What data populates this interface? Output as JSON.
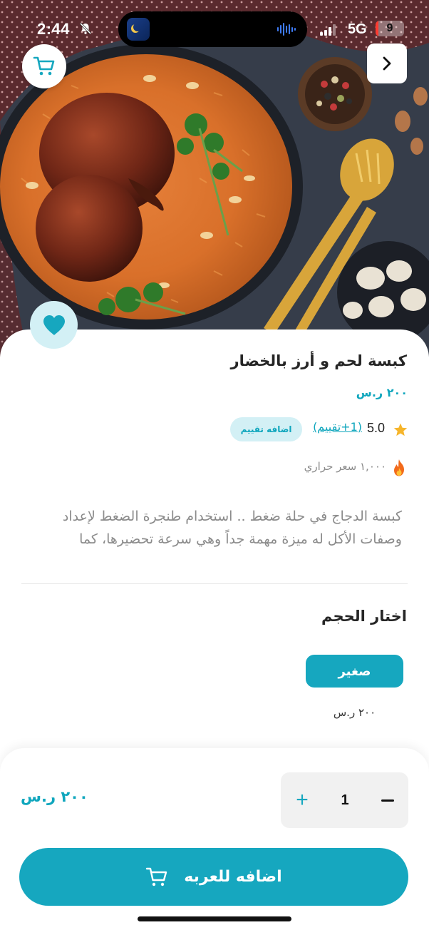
{
  "status_bar": {
    "time": "2:44",
    "network": "5G",
    "battery_level": "9",
    "battery_fraction": 0.09
  },
  "hero": {
    "image": "kabsa-chicken-rice-photo",
    "cart_icon": "cart-icon",
    "back_icon": "chevron-right-icon",
    "favorite_icon": "heart-icon"
  },
  "product": {
    "title": "كبسة لحم و أرز بالخضار",
    "price": "٢٠٠ ر.س",
    "rating": {
      "value": "5.0",
      "count_label": "(1+تقييم)",
      "add_rating_label": "اضافه تقييم"
    },
    "calories": "١,٠٠٠ سعر حراري",
    "description": "كبسة الدجاج في حلة ضغط .. استخدام طنجرة الضغط لإعداد وصفات الأكل له ميزة مهمة جداً وهي سرعة تحضيرها، كما"
  },
  "sizes": {
    "heading": "اختار الحجم",
    "options": [
      {
        "label": "صغير",
        "price": "٢٠٠ ر.س",
        "selected": true
      }
    ]
  },
  "cart_bar": {
    "total": "٢٠٠ ر.س",
    "quantity": "1",
    "plus_label": "+",
    "add_to_cart_label": "اضافه للعربه"
  },
  "colors": {
    "accent": "#16a7bf",
    "accent_text": "#0fa6bd",
    "accent_light": "#d3f0f5"
  }
}
